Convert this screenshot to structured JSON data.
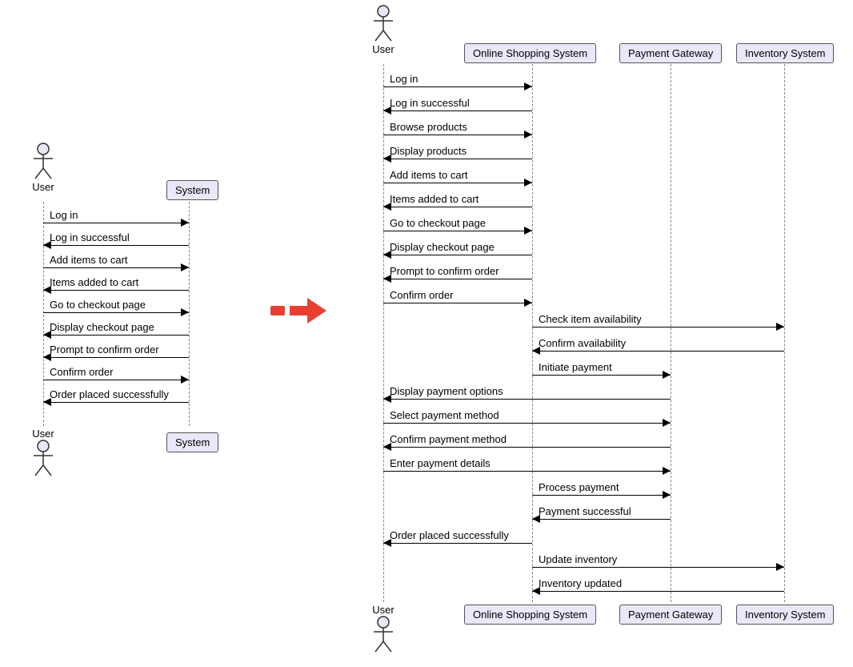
{
  "left": {
    "actor_label": "User",
    "system_label": "System",
    "messages": [
      {
        "text": "Log in",
        "dir": "r"
      },
      {
        "text": "Log in successful",
        "dir": "l"
      },
      {
        "text": "Add items to cart",
        "dir": "r"
      },
      {
        "text": "Items added to cart",
        "dir": "l"
      },
      {
        "text": "Go to checkout page",
        "dir": "r"
      },
      {
        "text": "Display checkout page",
        "dir": "l"
      },
      {
        "text": "Prompt to confirm order",
        "dir": "l"
      },
      {
        "text": "Confirm order",
        "dir": "r"
      },
      {
        "text": "Order placed successfully",
        "dir": "l"
      }
    ]
  },
  "right": {
    "actor_label": "User",
    "p1_label": "Online Shopping System",
    "p2_label": "Payment Gateway",
    "p3_label": "Inventory System",
    "messages": [
      {
        "text": "Log in",
        "from": 0,
        "to": 1,
        "dir": "r"
      },
      {
        "text": "Log in successful",
        "from": 1,
        "to": 0,
        "dir": "l"
      },
      {
        "text": "Browse products",
        "from": 0,
        "to": 1,
        "dir": "r"
      },
      {
        "text": "Display products",
        "from": 1,
        "to": 0,
        "dir": "l"
      },
      {
        "text": "Add items to cart",
        "from": 0,
        "to": 1,
        "dir": "r"
      },
      {
        "text": "Items added to cart",
        "from": 1,
        "to": 0,
        "dir": "l"
      },
      {
        "text": "Go to checkout page",
        "from": 0,
        "to": 1,
        "dir": "r"
      },
      {
        "text": "Display checkout page",
        "from": 1,
        "to": 0,
        "dir": "l"
      },
      {
        "text": "Prompt to confirm order",
        "from": 1,
        "to": 0,
        "dir": "l"
      },
      {
        "text": "Confirm order",
        "from": 0,
        "to": 1,
        "dir": "r"
      },
      {
        "text": "Check item availability",
        "from": 1,
        "to": 3,
        "dir": "r"
      },
      {
        "text": "Confirm availability",
        "from": 3,
        "to": 1,
        "dir": "l"
      },
      {
        "text": "Initiate payment",
        "from": 1,
        "to": 2,
        "dir": "r"
      },
      {
        "text": "Display payment options",
        "from": 2,
        "to": 0,
        "dir": "l"
      },
      {
        "text": "Select payment method",
        "from": 0,
        "to": 2,
        "dir": "r"
      },
      {
        "text": "Confirm payment method",
        "from": 2,
        "to": 0,
        "dir": "l"
      },
      {
        "text": "Enter payment details",
        "from": 0,
        "to": 2,
        "dir": "r"
      },
      {
        "text": "Process payment",
        "from": 1,
        "to": 2,
        "dir": "r"
      },
      {
        "text": "Payment successful",
        "from": 2,
        "to": 1,
        "dir": "l"
      },
      {
        "text": "Order placed successfully",
        "from": 1,
        "to": 0,
        "dir": "l"
      },
      {
        "text": "Update inventory",
        "from": 1,
        "to": 3,
        "dir": "r"
      },
      {
        "text": "Inventory updated",
        "from": 3,
        "to": 1,
        "dir": "l"
      }
    ]
  }
}
